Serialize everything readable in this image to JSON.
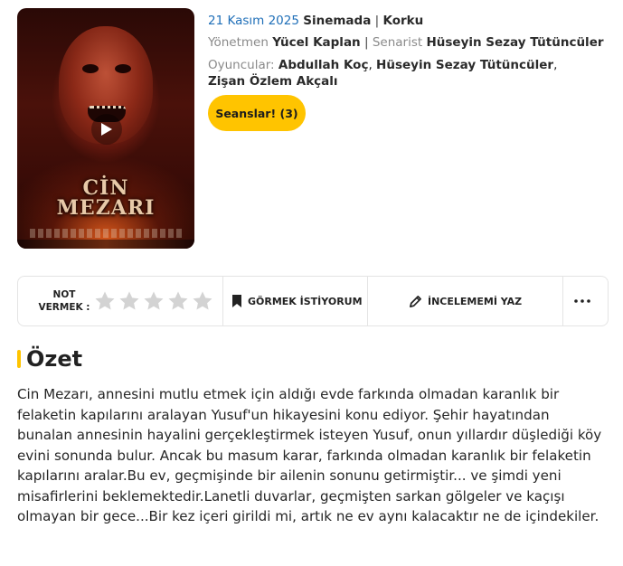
{
  "movie": {
    "release_date": "21 Kasım 2025",
    "status": "Sinemada",
    "genre": "Korku",
    "director_label": "Yönetmen",
    "director": "Yücel Kaplan",
    "writer_label": "Senarist",
    "writer": "Hüseyin Sezay Tütüncüler",
    "cast_label": "Oyuncular:",
    "cast": [
      "Abdullah Koç",
      "Hüseyin Sezay Tütüncüler",
      "Zişan Özlem Akçalı"
    ],
    "poster_title_line1": "CİN",
    "poster_title_line2": "MEZARI"
  },
  "buttons": {
    "showtimes_label": "Seanslar! (3)"
  },
  "actions": {
    "rate_label_line1": "NOT",
    "rate_label_line2": "VERMEK :",
    "star_count": 5,
    "rating_value": 0,
    "star_color_empty": "#d3d3d3",
    "watchlist_label": "GÖRMEK İSTİYORUM",
    "review_label": "İNCELEMEMİ YAZ",
    "more_label": "•••"
  },
  "summary": {
    "heading": "Özet",
    "text": "Cin Mezarı, annesini mutlu etmek için aldığı evde farkında olmadan karanlık bir felaketin kapılarını aralayan Yusuf'un hikayesini konu ediyor. Şehir hayatından bunalan annesinin hayalini gerçekleştirmek isteyen Yusuf, onun yıllardır düşlediği köy evini sonunda bulur. Ancak bu masum karar, farkında olmadan karanlık bir felaketin kapılarını aralar.Bu ev, geçmişinde bir ailenin sonunu getirmiştir... ve şimdi yeni misafirlerini beklemektedir.Lanetli duvarlar, geçmişten sarkan gölgeler ve kaçışı olmayan bir gece...Bir kez içeri girildi mi, artık ne ev aynı kalacaktır ne de içindekiler."
  },
  "colors": {
    "accent_yellow": "#ffc400",
    "date_blue": "#1f6fb8"
  },
  "icons": {
    "play": "play-icon",
    "bookmark": "bookmark-icon",
    "pencil": "pencil-icon",
    "more": "more-dots-icon"
  }
}
